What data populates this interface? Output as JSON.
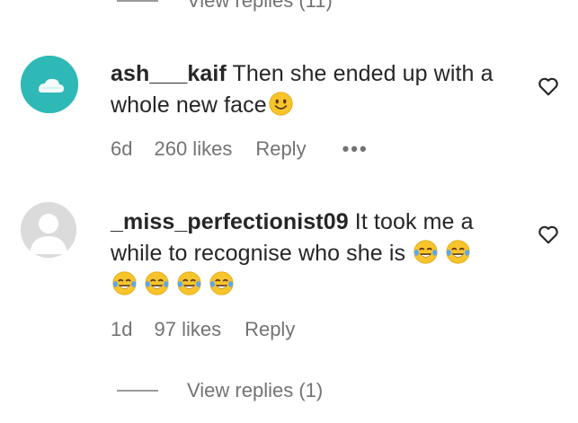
{
  "top_thread": {
    "view_replies": "View replies (11)"
  },
  "comments": [
    {
      "username": "ash___kaif",
      "text": "Then she ended up with a whole new face",
      "emoji_count": 1,
      "age": "6d",
      "likes": "260 likes",
      "reply": "Reply",
      "more": "•••"
    },
    {
      "username": "_miss_perfectionist09",
      "text": "It took me a while to recognise who she is",
      "emoji_count": 6,
      "age": "1d",
      "likes": "97 likes",
      "reply": "Reply"
    }
  ],
  "bottom_thread": {
    "view_replies": "View replies (1)"
  },
  "icons": {
    "avatar1": "cloud-avatar-icon",
    "avatar2": "default-avatar-icon",
    "like": "heart-outline-icon",
    "emoji1": "slightly-smiling-face",
    "emoji2": "face-with-tears-of-joy"
  },
  "colors": {
    "avatar1_bg": "#2fb9b6",
    "muted_text": "#737373"
  }
}
